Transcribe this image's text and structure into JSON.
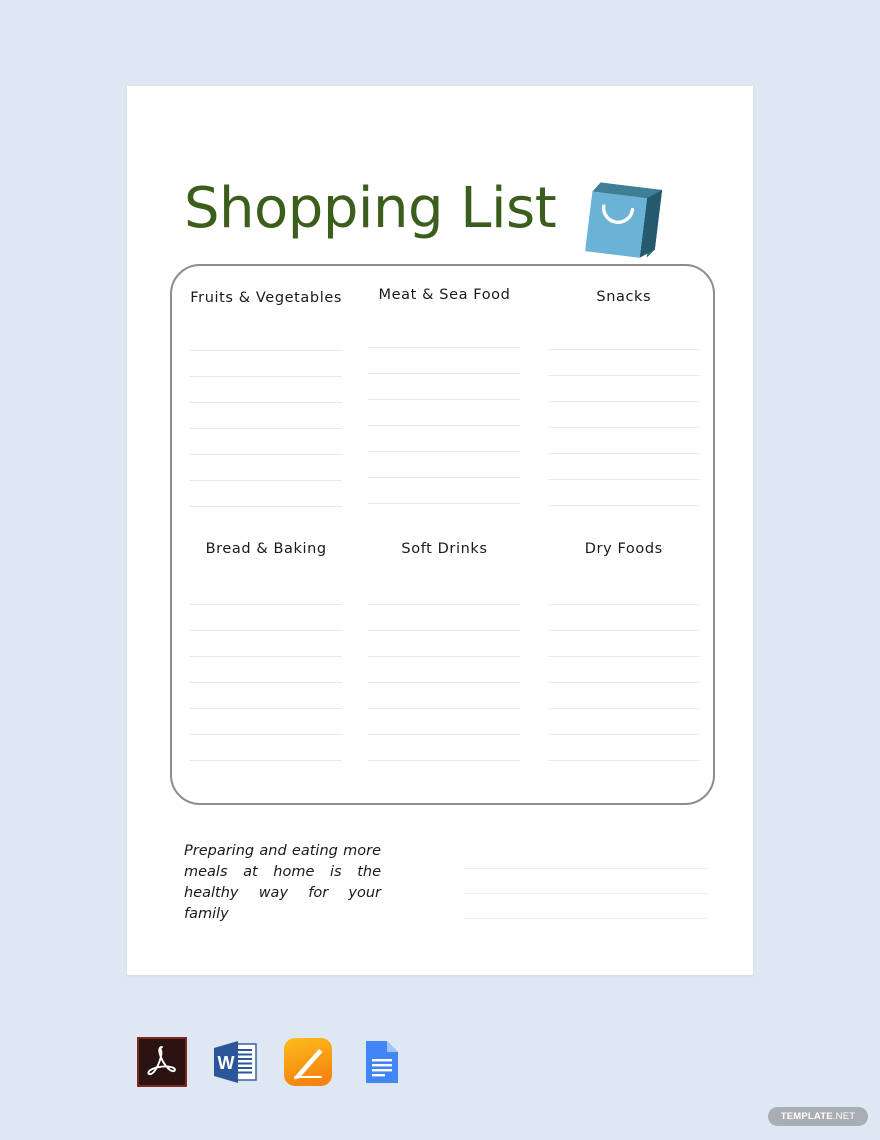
{
  "page": {
    "title": "Shopping List",
    "title_color": "#3c5e1c",
    "background_color": "#dfe8f2",
    "paper_color": "#ffffff"
  },
  "icons": {
    "shopping_bag": "shopping-bag-icon",
    "bag_front_color": "#6bb3d6",
    "bag_side_color": "#2c6a80",
    "bag_handle_color": "#ffffff"
  },
  "list_card": {
    "border_color": "#8d8d8d",
    "rule_color": "#e9e9e9",
    "blocks": [
      {
        "columns": [
          {
            "heading": "Fruits & Vegetables",
            "line_count": 7
          },
          {
            "heading": "Meat & Sea Food",
            "line_count": 7
          },
          {
            "heading": "Snacks",
            "line_count": 7
          }
        ]
      },
      {
        "columns": [
          {
            "heading": "Bread & Baking",
            "line_count": 7
          },
          {
            "heading": "Soft Drinks",
            "line_count": 7
          },
          {
            "heading": "Dry Foods",
            "line_count": 7
          }
        ]
      }
    ]
  },
  "footer": {
    "quote": "Preparing and eating more meals at home is the healthy way for your family",
    "note_line_count": 3,
    "note_rule_color": "#eceef1"
  },
  "formats": [
    {
      "name": "pdf-icon",
      "label": "PDF",
      "color": "#2a1310"
    },
    {
      "name": "word-icon",
      "label": "MS Word",
      "color": "#2b579a"
    },
    {
      "name": "pages-icon",
      "label": "Apple Pages",
      "color": "#f5a623"
    },
    {
      "name": "google-docs-icon",
      "label": "Google Docs",
      "color": "#4285f4"
    }
  ],
  "watermark": {
    "text_bold": "TEMPLATE",
    "text_light": ".NET",
    "background": "#a9adb4"
  }
}
